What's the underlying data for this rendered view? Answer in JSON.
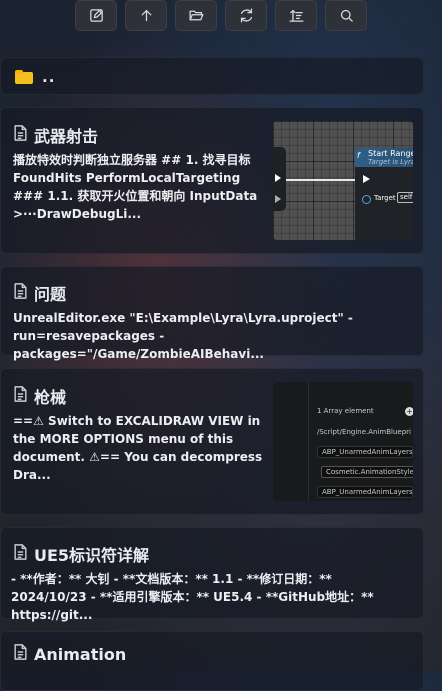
{
  "toolbar": {
    "buttons": [
      {
        "icon": "edit-icon"
      },
      {
        "icon": "arrow-up-icon"
      },
      {
        "icon": "folder-open-icon"
      },
      {
        "icon": "refresh-icon"
      },
      {
        "icon": "sort-icon"
      },
      {
        "icon": "search-icon"
      }
    ]
  },
  "parent": {
    "label": ".."
  },
  "notes": [
    {
      "title": "武器射击",
      "excerpt": "播放特效时判断独立服务器 ## 1. 找寻目标FoundHits PerformLocalTargeting ### 1.1. 获取开火位置和朝向 InputData >···DrawDebugLi...",
      "thumb": {
        "fx": "f",
        "node_title": "Start Range",
        "node_subtitle": "Target is Lyra",
        "pin_label": "Target",
        "pin_value": "self"
      }
    },
    {
      "title": "问题",
      "excerpt": "UnrealEditor.exe \"E:\\Example\\Lyra\\Lyra.uproject\" -run=resavepackages -packages=\"/Game/ZombieAIBehavi..."
    },
    {
      "title": "枪械",
      "excerpt": "==⚠ Switch to EXCALIDRAW VIEW in the MORE OPTIONS menu of this document. ⚠== You can decompress Dra...",
      "thumb": {
        "array_label": "1 Array element",
        "path": "/Script/Engine.AnimBluepri",
        "items": [
          "ABP_UnarmedAnimLayers",
          "Cosmetic.AnimationStyle",
          "ABP_UnarmedAnimLayers"
        ]
      }
    },
    {
      "title": "UE5标识符详解",
      "excerpt": "- **作者：** 大钊 - **文档版本：** 1.1 - **修订日期：** 2024/10/23 - **适用引擎版本：** UE5.4 - **GitHub地址：** https://git..."
    },
    {
      "title": "Animation",
      "excerpt": ""
    }
  ]
}
